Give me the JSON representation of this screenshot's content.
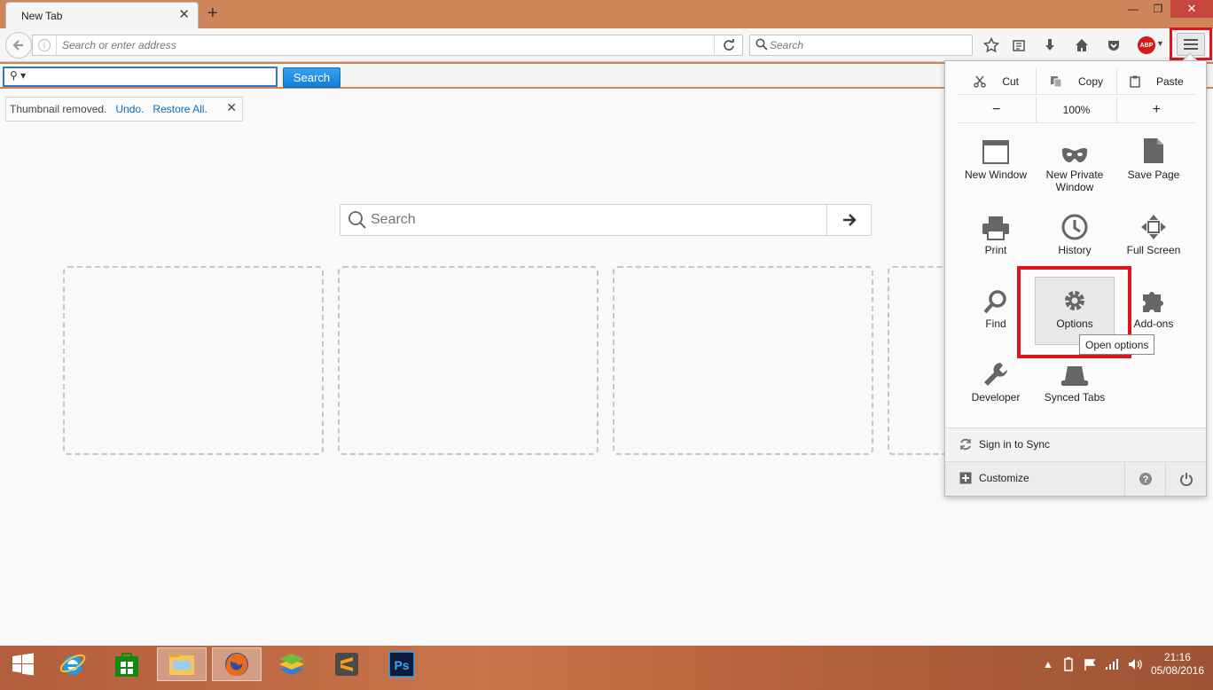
{
  "window": {
    "tab_title": "New Tab",
    "tab_close": "✕",
    "new_tab": "+",
    "minimize": "—",
    "restore": "❐",
    "close": "✕"
  },
  "navbar": {
    "url_placeholder": "Search or enter address",
    "search_placeholder": "Search",
    "abp_label": "ABP"
  },
  "toolbar2": {
    "search_button": "Search"
  },
  "notification": {
    "message": "Thumbnail removed.",
    "undo": "Undo.",
    "restore_all": "Restore All.",
    "close": "✕"
  },
  "newtab": {
    "search_placeholder": "Search"
  },
  "menu": {
    "edit": {
      "cut": "Cut",
      "copy": "Copy",
      "paste": "Paste"
    },
    "zoom": {
      "minus": "−",
      "level": "100%",
      "plus": "+"
    },
    "items": {
      "new_window": "New Window",
      "new_private_window": "New Private Window",
      "save_page": "Save Page",
      "print": "Print",
      "history": "History",
      "full_screen": "Full Screen",
      "find": "Find",
      "options": "Options",
      "addons": "Add-ons",
      "developer": "Developer",
      "synced_tabs": "Synced Tabs"
    },
    "tooltip": "Open options",
    "sign_in": "Sign in to Sync",
    "customize": "Customize"
  },
  "taskbar": {
    "time": "21:16",
    "date": "05/08/2016",
    "ps_label": "Ps"
  },
  "colors": {
    "accent_orange": "#cd8559",
    "highlight_red": "#e0141e",
    "link_blue": "#0c6db6"
  }
}
